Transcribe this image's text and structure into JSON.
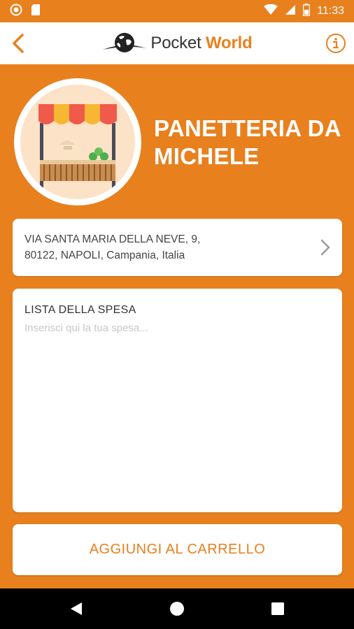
{
  "status_bar": {
    "time": "11:33"
  },
  "app_bar": {
    "brand_plain": "Pocket",
    "brand_accent": "World"
  },
  "shop": {
    "name": "PANETTERIA DA MICHELE",
    "image_icon": "market-stall-icon"
  },
  "address": {
    "line1": "VIA SANTA MARIA DELLA NEVE, 9,",
    "line2": "80122, NAPOLI, Campania, Italia"
  },
  "shopping_list": {
    "label": "LISTA DELLA SPESA",
    "placeholder": "Inserisci qui la tua spesa...",
    "value": ""
  },
  "actions": {
    "add_to_cart": "AGGIUNGI AL CARRELLO"
  },
  "colors": {
    "accent": "#E8801E",
    "card": "#FFFFFF",
    "nav_bar": "#000000"
  }
}
